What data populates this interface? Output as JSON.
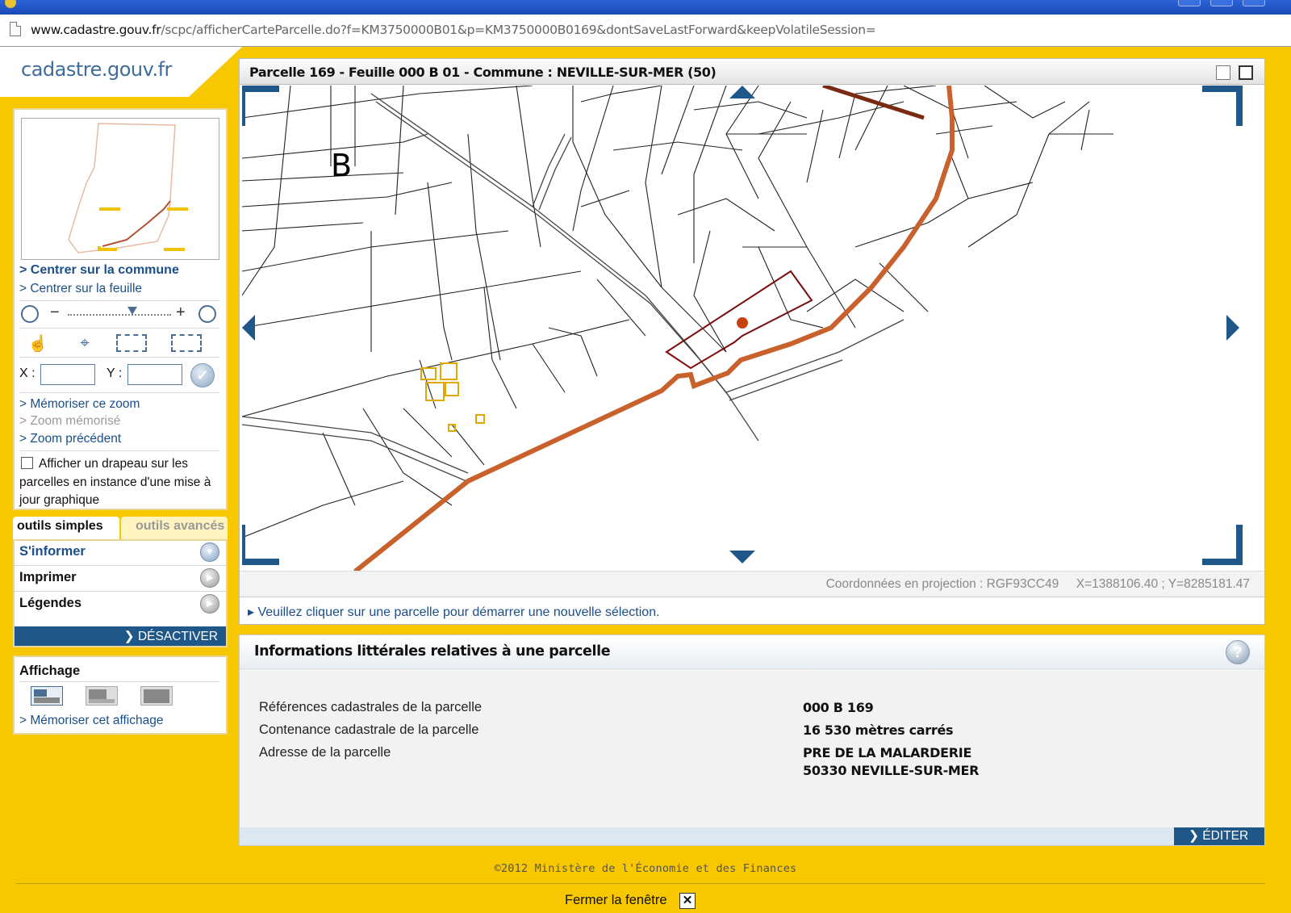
{
  "browser": {
    "url_host": "www.cadastre.gouv.fr",
    "url_path": "/scpc/afficherCarteParcelle.do?f=KM3750000B01&p=KM3750000B0169&dontSaveLastForward&keepVolatileSession="
  },
  "logo": "cadastre.gouv.fr",
  "nav": {
    "center_commune": "> Centrer sur la commune",
    "center_sheet": "> Centrer sur la feuille",
    "zoom_minus": "−",
    "zoom_plus": "+",
    "x_label": "X :",
    "y_label": "Y :",
    "x_value": "",
    "y_value": "",
    "save_zoom": "> Mémoriser ce zoom",
    "saved_zoom": "> Zoom mémorisé",
    "previous_zoom": "> Zoom précédent",
    "flag_checkbox_label": "Afficher un drapeau sur les parcelles en instance d'une mise à jour graphique",
    "flag_checked": false
  },
  "tools": {
    "tab_simple": "outils simples",
    "tab_advanced": "outils avancés",
    "items": [
      {
        "label": "S'informer",
        "active": true
      },
      {
        "label": "Imprimer",
        "active": false
      },
      {
        "label": "Légendes",
        "active": false
      }
    ],
    "deactivate": "❯ DÉSACTIVER"
  },
  "display": {
    "title": "Affichage",
    "save_display": "> Mémoriser cet affichage"
  },
  "map": {
    "title": "Parcelle 169 - Feuille 000 B 01 - Commune : NEVILLE-SUR-MER (50)",
    "section_letter": "B",
    "coords_label": "Coordonnées en projection : RGF93CC49",
    "coords_value": "X=1388106.40 ; Y=8285181.47",
    "select_hint": "▸ Veuillez cliquer sur une parcelle pour démarrer une nouvelle sélection."
  },
  "info": {
    "title": "Informations littérales relatives à une parcelle",
    "rows": [
      {
        "label": "Références cadastrales de la parcelle",
        "value": "000 B 169"
      },
      {
        "label": "Contenance cadastrale de la parcelle",
        "value": "16 530 mètres carrés"
      },
      {
        "label": "Adresse de la parcelle",
        "value": "PRE DE LA MALARDERIE",
        "value2": "50330 NEVILLE-SUR-MER"
      }
    ],
    "edit": "❯ ÉDITER",
    "help": "?"
  },
  "footer": {
    "copyright": "©2012 Ministère de l'Économie et des Finances",
    "close_window": "Fermer la fenêtre",
    "close_x": "✕"
  },
  "colors": {
    "background_yellow": "#f7c700",
    "accent_blue": "#1f5789",
    "link_blue": "#1b4f8a",
    "commune_boundary": "#c8612c",
    "selected_parcel": "#7a0c0c"
  }
}
